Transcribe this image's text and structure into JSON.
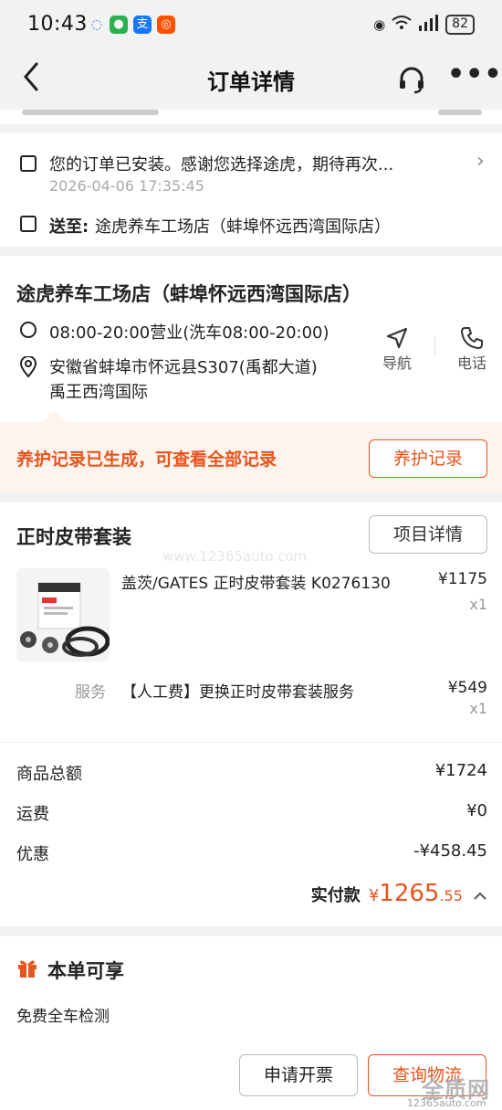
{
  "status_bar": {
    "time": "10:43",
    "battery": "82"
  },
  "nav": {
    "title": "订单详情"
  },
  "order_status": {
    "message": "您的订单已安装。感谢您选择途虎，期待再次...",
    "timestamp": "2026-04-06 17:35:45",
    "delivery_label": "送至:",
    "delivery_value": "途虎养车工场店（蚌埠怀远西湾国际店）"
  },
  "store": {
    "name": "途虎养车工场店（蚌埠怀远西湾国际店）",
    "hours": "08:00-20:00营业(洗车08:00-20:00)",
    "address_line1": "安徽省蚌埠市怀远县S307(禹都大道)",
    "address_line2": "禹王西湾国际",
    "navigate_label": "导航",
    "call_label": "电话"
  },
  "maintenance": {
    "message": "养护记录已生成，可查看全部记录",
    "button": "养护记录"
  },
  "package": {
    "title": "正时皮带套装",
    "details_button": "项目详情",
    "watermark": "www.12365auto.com",
    "product": {
      "name": "盖茨/GATES 正时皮带套装 K0276130",
      "price": "¥1175",
      "qty": "x1"
    },
    "service": {
      "tag": "服务",
      "name": "【人工费】更换正时皮带套装服务",
      "price": "¥549",
      "qty": "x1"
    }
  },
  "summary": {
    "rows": [
      {
        "label": "商品总额",
        "value": "¥1724"
      },
      {
        "label": "运费",
        "value": "¥0"
      },
      {
        "label": "优惠",
        "value": "-¥458.45"
      }
    ],
    "paid_label": "实付款",
    "paid_currency": "¥",
    "paid_int": "1265",
    "paid_dec": ".55"
  },
  "benefits": {
    "title": "本单可享",
    "item": "免费全车检测"
  },
  "actions": {
    "invoice": "申请开票",
    "logistics": "查询物流"
  },
  "corner_watermark": {
    "text": "全质网",
    "url": "12365auto.com"
  },
  "colors": {
    "accent": "#e8541e",
    "background": "#f2f2f2"
  }
}
